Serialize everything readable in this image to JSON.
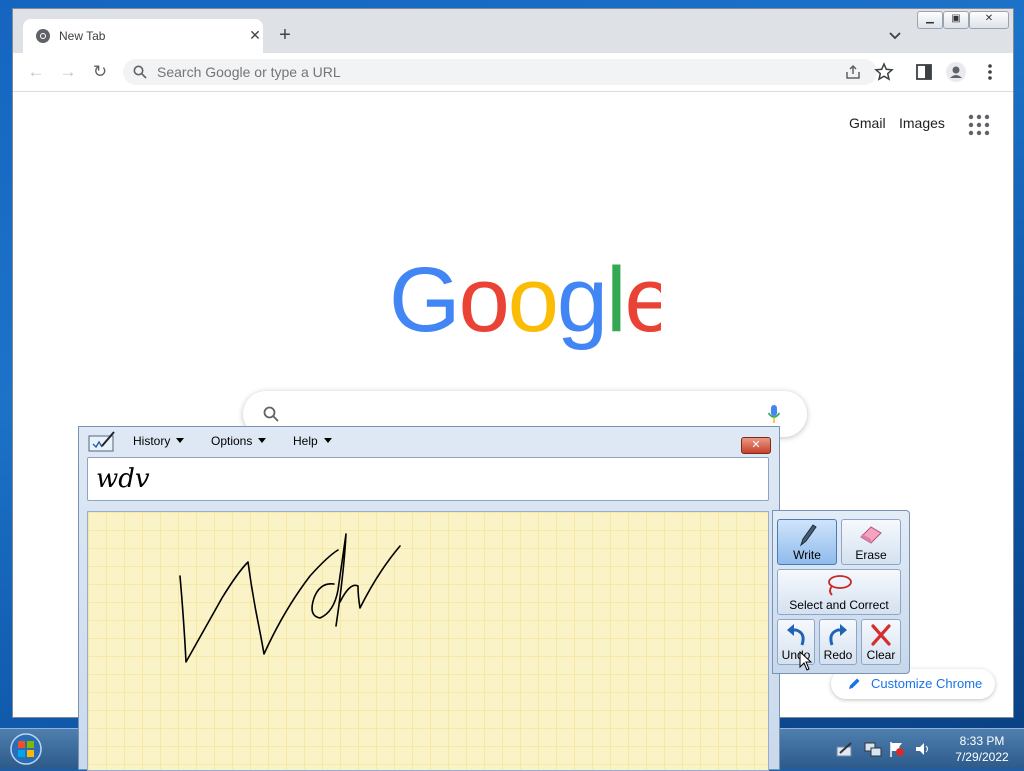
{
  "browser": {
    "tab_title": "New Tab",
    "omnibox_placeholder": "Search Google or type a URL"
  },
  "page": {
    "links": {
      "gmail": "Gmail",
      "images": "Images"
    },
    "customize_label": "Customize Chrome"
  },
  "tip": {
    "menu": {
      "history": "History",
      "options": "Options",
      "help": "Help"
    },
    "recognized_text": "wdv",
    "tools": {
      "write": "Write",
      "erase": "Erase",
      "select_correct": "Select and Correct",
      "undo": "Undo",
      "redo": "Redo",
      "clear": "Clear"
    }
  },
  "taskbar": {
    "time": "8:33 PM",
    "date": "7/29/2022"
  },
  "colors": {
    "google_blue": "#4285F4",
    "google_red": "#EA4335",
    "google_yellow": "#FBBC05",
    "google_green": "#34A853"
  }
}
